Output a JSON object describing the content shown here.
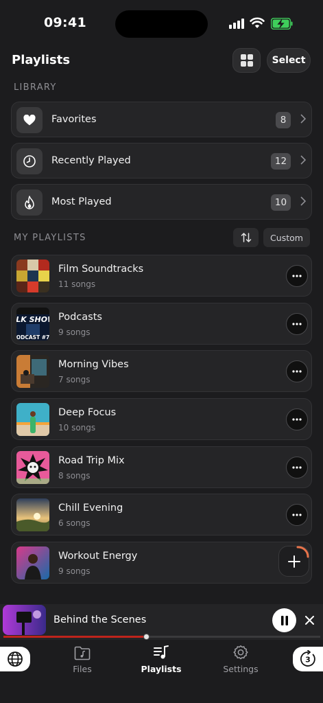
{
  "status_bar": {
    "time": "09:41"
  },
  "header": {
    "title": "Playlists",
    "grid_icon": "grid-view-icon",
    "select_label": "Select"
  },
  "library": {
    "label": "LIBRARY",
    "items": [
      {
        "label": "Favorites",
        "count": "8",
        "icon": "heart-icon"
      },
      {
        "label": "Recently Played",
        "count": "12",
        "icon": "clock-icon"
      },
      {
        "label": "Most Played",
        "count": "10",
        "icon": "flame-icon"
      }
    ]
  },
  "my_playlists": {
    "label": "MY PLAYLISTS",
    "sort_icon": "sort-arrows-icon",
    "sort_mode": "Custom",
    "items": [
      {
        "name": "Film Soundtracks",
        "songs": "11 songs"
      },
      {
        "name": "Podcasts",
        "songs": "9 songs"
      },
      {
        "name": "Morning Vibes",
        "songs": "7 songs"
      },
      {
        "name": "Deep Focus",
        "songs": "10 songs"
      },
      {
        "name": "Road Trip Mix",
        "songs": "8 songs"
      },
      {
        "name": "Chill Evening",
        "songs": "6 songs"
      },
      {
        "name": "Workout Energy",
        "songs": "9 songs"
      }
    ],
    "thumb_text": {
      "podcast_top": "ALK SHOW",
      "podcast_bottom": "ODCAST #7"
    }
  },
  "now_playing": {
    "title": "Behind the Scenes",
    "progress": 0.45,
    "accent": "#c0241c"
  },
  "tab_bar": {
    "tabs": [
      {
        "label": "Files",
        "icon": "music-folder-icon"
      },
      {
        "label": "Playlists",
        "icon": "playlist-icon",
        "active": true
      },
      {
        "label": "Settings",
        "icon": "gear-icon"
      }
    ],
    "timer_value": "3"
  }
}
